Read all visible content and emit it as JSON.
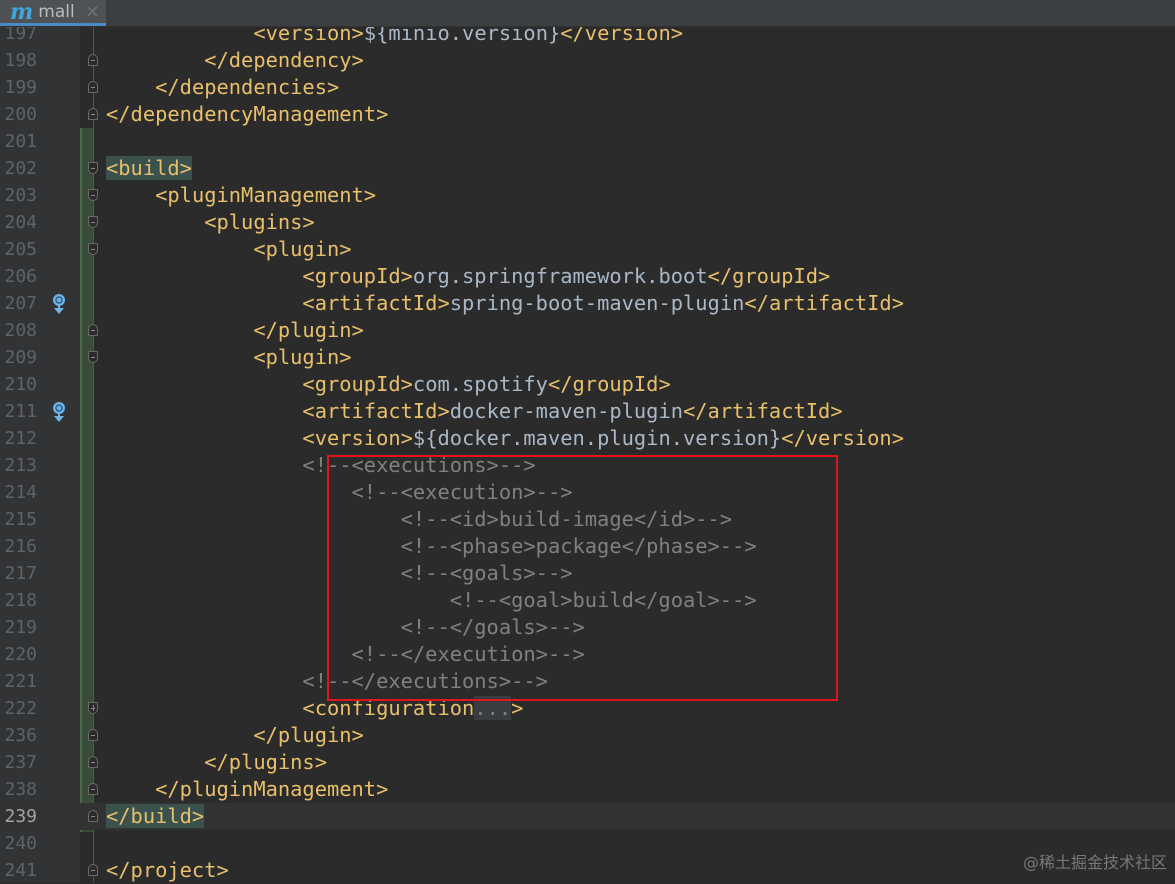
{
  "tab": {
    "icon": "maven-icon",
    "label": "mall",
    "close": "×"
  },
  "lines": [
    {
      "n": "197",
      "text": "            <version>${minio.version}</version>"
    },
    {
      "n": "198",
      "text": "        </dependency>",
      "fold": "end"
    },
    {
      "n": "199",
      "text": "    </dependencies>",
      "fold": "end"
    },
    {
      "n": "200",
      "text": "</dependencyManagement>",
      "fold": "end"
    },
    {
      "n": "201",
      "text": ""
    },
    {
      "n": "202",
      "text": "<build>",
      "fold": "start",
      "match": true
    },
    {
      "n": "203",
      "text": "    <pluginManagement>",
      "fold": "start"
    },
    {
      "n": "204",
      "text": "        <plugins>",
      "fold": "start"
    },
    {
      "n": "205",
      "text": "            <plugin>",
      "fold": "start"
    },
    {
      "n": "206",
      "text": "                <groupId>org.springframework.boot</groupId>"
    },
    {
      "n": "207",
      "text": "                <artifactId>spring-boot-maven-plugin</artifactId>",
      "gicon": true
    },
    {
      "n": "208",
      "text": "            </plugin>",
      "fold": "end"
    },
    {
      "n": "209",
      "text": "            <plugin>",
      "fold": "start"
    },
    {
      "n": "210",
      "text": "                <groupId>com.spotify</groupId>"
    },
    {
      "n": "211",
      "text": "                <artifactId>docker-maven-plugin</artifactId>",
      "gicon": true
    },
    {
      "n": "212",
      "text": "                <version>${docker.maven.plugin.version}</version>"
    },
    {
      "n": "213",
      "text": "                <!--<executions>-->"
    },
    {
      "n": "214",
      "text": "                    <!--<execution>-->"
    },
    {
      "n": "215",
      "text": "                        <!--<id>build-image</id>-->"
    },
    {
      "n": "216",
      "text": "                        <!--<phase>package</phase>-->"
    },
    {
      "n": "217",
      "text": "                        <!--<goals>-->"
    },
    {
      "n": "218",
      "text": "                            <!--<goal>build</goal>-->"
    },
    {
      "n": "219",
      "text": "                        <!--</goals>-->"
    },
    {
      "n": "220",
      "text": "                    <!--</execution>-->"
    },
    {
      "n": "221",
      "text": "                <!--</executions>-->"
    },
    {
      "n": "222",
      "text": "                <configuration",
      "fold": "plus",
      "folded": "...",
      "after": ">"
    },
    {
      "n": "236",
      "text": "            </plugin>",
      "fold": "end"
    },
    {
      "n": "237",
      "text": "        </plugins>",
      "fold": "end"
    },
    {
      "n": "238",
      "text": "    </pluginManagement>",
      "fold": "end"
    },
    {
      "n": "239",
      "text": "</build>",
      "fold": "end",
      "match": true,
      "current": true,
      "bulb": true
    },
    {
      "n": "240",
      "text": ""
    },
    {
      "n": "241",
      "text": "</project>",
      "fold": "end",
      "outdent": true
    }
  ],
  "watermark": "@稀土掘金技术社区"
}
